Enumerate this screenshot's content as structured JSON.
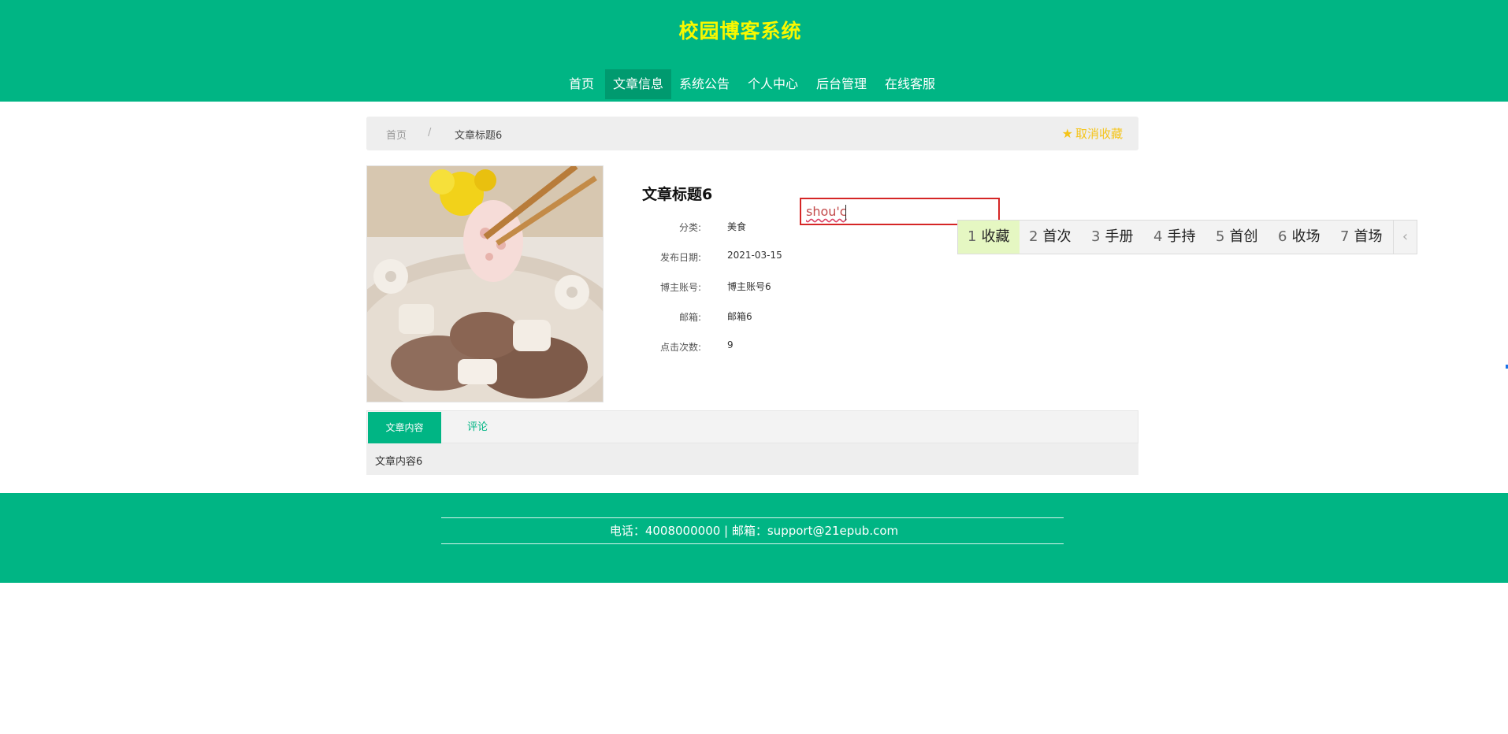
{
  "header": {
    "site_title": "校园博客系统",
    "nav": [
      {
        "label": "首页",
        "active": false
      },
      {
        "label": "文章信息",
        "active": true
      },
      {
        "label": "系统公告",
        "active": false
      },
      {
        "label": "个人中心",
        "active": false
      },
      {
        "label": "后台管理",
        "active": false
      },
      {
        "label": "在线客服",
        "active": false
      }
    ]
  },
  "breadcrumb": {
    "home": "首页",
    "separator": "/",
    "current": "文章标题6",
    "favorite_icon": "star-icon",
    "favorite_label": "取消收藏"
  },
  "article": {
    "image_alt": "lotus-root-soup-image",
    "title": "文章标题6",
    "fields": [
      {
        "label": "分类:",
        "value": "美食"
      },
      {
        "label": "发布日期:",
        "value": "2021-03-15"
      },
      {
        "label": "博主账号:",
        "value": "博主账号6"
      },
      {
        "label": "邮箱:",
        "value": "邮箱6"
      },
      {
        "label": "点击次数:",
        "value": "9"
      }
    ]
  },
  "ime": {
    "input_text": "shou'c",
    "candidates": [
      {
        "num": "1",
        "text": "收藏",
        "selected": true
      },
      {
        "num": "2",
        "text": "首次"
      },
      {
        "num": "3",
        "text": "手册"
      },
      {
        "num": "4",
        "text": "手持"
      },
      {
        "num": "5",
        "text": "首创"
      },
      {
        "num": "6",
        "text": "收场"
      },
      {
        "num": "7",
        "text": "首场"
      }
    ],
    "prev_icon": "chevron-left-icon",
    "prev_glyph": "‹"
  },
  "tabs": {
    "content_tab": "文章内容",
    "comment_tab": "评论",
    "content_text": "文章内容6"
  },
  "footer": {
    "contact": "电话：4008000000 | 邮箱：support@21epub.com"
  },
  "colors": {
    "brand": "#00b584",
    "title": "#f8f800",
    "favorite": "#f5c418"
  }
}
